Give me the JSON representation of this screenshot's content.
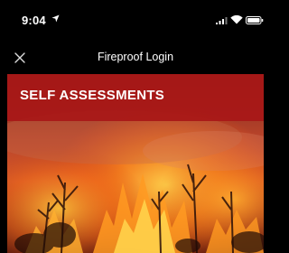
{
  "status_bar": {
    "time": "9:04",
    "icons": [
      "location-arrow-icon",
      "cellular-signal-icon",
      "wifi-icon",
      "battery-icon"
    ]
  },
  "nav_bar": {
    "title": "Fireproof Login",
    "close_icon": "close-icon"
  },
  "banner": {
    "title": "SELF ASSESSMENTS"
  },
  "hero_image": {
    "subject": "wildfire-photo"
  },
  "colors": {
    "bar_background": "#000000",
    "banner_red": "#a81717",
    "text": "#ffffff"
  }
}
